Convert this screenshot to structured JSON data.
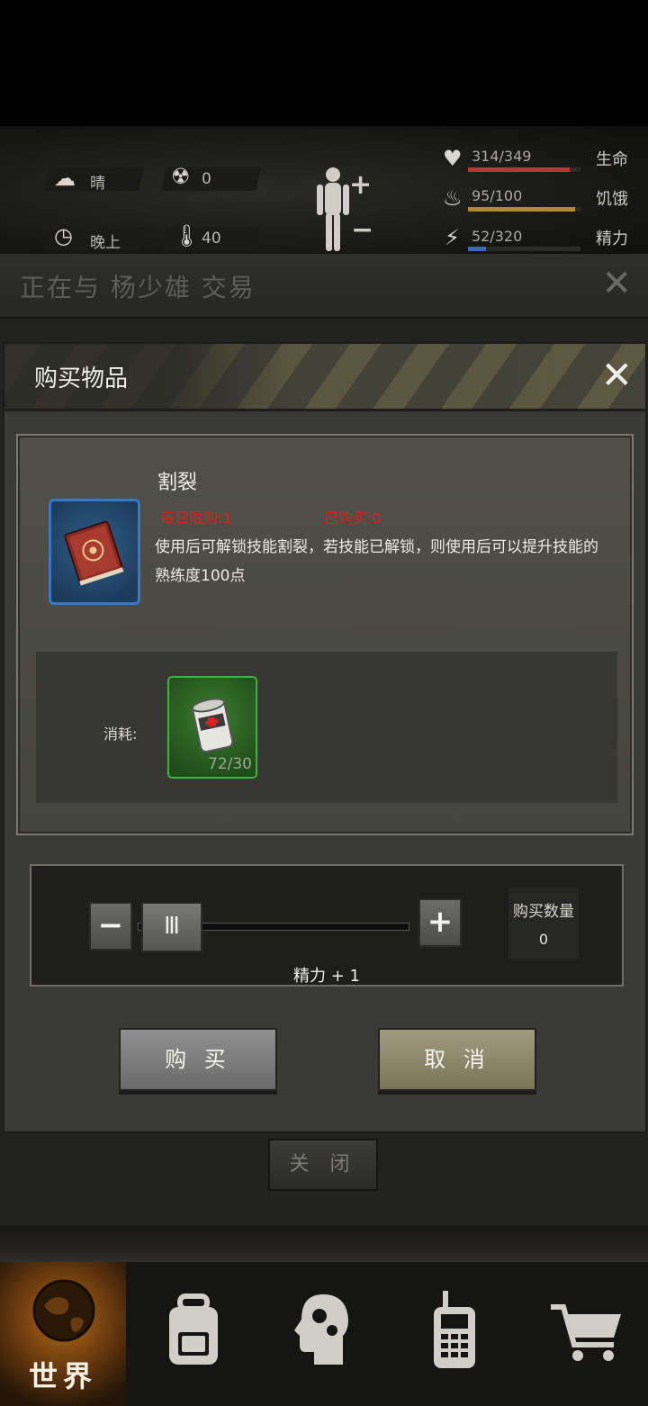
{
  "status": {
    "weather_label": "晴",
    "radiation_value": "0",
    "time_label": "晚上",
    "temperature_value": "40",
    "health": {
      "text": "314/349",
      "name": "生命",
      "fraction": 0.9,
      "color": "#b23a3a"
    },
    "hunger": {
      "text": "95/100",
      "name": "饥饿",
      "fraction": 0.95,
      "color": "#b08a3a"
    },
    "energy": {
      "text": "52/320",
      "name": "精力",
      "fraction": 0.16,
      "color": "#3a6ab2"
    }
  },
  "trade": {
    "title": "正在与 杨少雄 交易",
    "close_icon": "close-icon",
    "close_button_label": "关 闭"
  },
  "dialog": {
    "title": "购买物品",
    "item": {
      "name": "割裂",
      "daily_limit": "每日限购:1",
      "purchased": "已购买:0",
      "description": "使用后可解锁技能割裂，若技能已解锁，则使用后可以提升技能的熟练度100点",
      "icon": "skill-book-icon"
    },
    "cost": {
      "label": "消耗:",
      "item_icon": "bandage-icon",
      "count": "72/30"
    },
    "quantity": {
      "label": "购买数量",
      "value": "0",
      "effect": "精力 + 1"
    },
    "buy_label": "购 买",
    "cancel_label": "取 消"
  },
  "nav": {
    "world_label": "世界",
    "items": [
      "world-icon",
      "backpack-icon",
      "skills-icon",
      "radio-icon",
      "shop-cart-icon"
    ]
  },
  "colors": {
    "limit_red": "#e11e1e",
    "cost_green": "#3db23d",
    "item_blue": "#3b78c4"
  }
}
